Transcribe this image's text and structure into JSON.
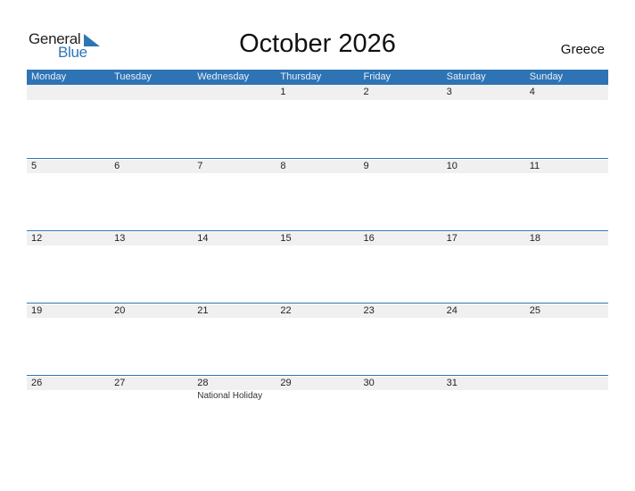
{
  "logo": {
    "general": "General",
    "blue": "Blue",
    "accent": "#2e75b6"
  },
  "title": "October 2026",
  "country": "Greece",
  "colors": {
    "header_bg": "#2e74b5",
    "date_strip": "#f0f0f0"
  },
  "weekdays": [
    "Monday",
    "Tuesday",
    "Wednesday",
    "Thursday",
    "Friday",
    "Saturday",
    "Sunday"
  ],
  "weeks": [
    {
      "days": [
        {
          "num": ""
        },
        {
          "num": ""
        },
        {
          "num": ""
        },
        {
          "num": "1"
        },
        {
          "num": "2"
        },
        {
          "num": "3"
        },
        {
          "num": "4"
        }
      ]
    },
    {
      "days": [
        {
          "num": "5"
        },
        {
          "num": "6"
        },
        {
          "num": "7"
        },
        {
          "num": "8"
        },
        {
          "num": "9"
        },
        {
          "num": "10"
        },
        {
          "num": "11"
        }
      ]
    },
    {
      "days": [
        {
          "num": "12"
        },
        {
          "num": "13"
        },
        {
          "num": "14"
        },
        {
          "num": "15"
        },
        {
          "num": "16"
        },
        {
          "num": "17"
        },
        {
          "num": "18"
        }
      ]
    },
    {
      "days": [
        {
          "num": "19"
        },
        {
          "num": "20"
        },
        {
          "num": "21"
        },
        {
          "num": "22"
        },
        {
          "num": "23"
        },
        {
          "num": "24"
        },
        {
          "num": "25"
        }
      ]
    },
    {
      "days": [
        {
          "num": "26"
        },
        {
          "num": "27"
        },
        {
          "num": "28",
          "event": "National Holiday"
        },
        {
          "num": "29"
        },
        {
          "num": "30"
        },
        {
          "num": "31"
        },
        {
          "num": ""
        }
      ]
    }
  ]
}
